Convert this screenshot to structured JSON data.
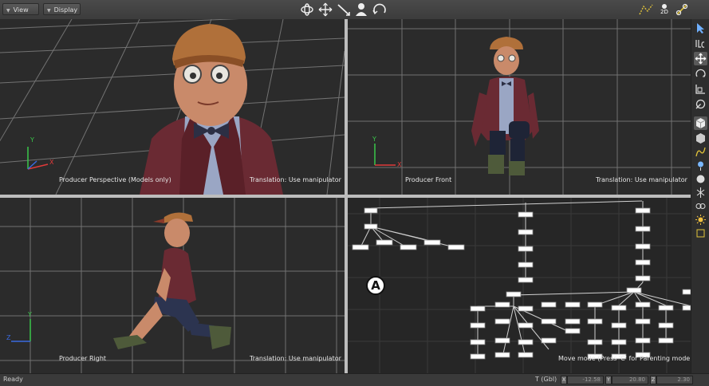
{
  "menu": {
    "view_label": "View",
    "display_label": "Display"
  },
  "toolbar": {
    "view_2d_label": "2D"
  },
  "viewports": {
    "perspective": {
      "name": "Producer Perspective (Models only)",
      "mode": "Translation: Use manipulator"
    },
    "front": {
      "name": "Producer Front",
      "mode": "Translation: Use manipulator"
    },
    "right": {
      "name": "Producer Right",
      "mode": "Translation: Use manipulator"
    },
    "schematic": {
      "mode": "Move mode (Press 'C' for Parenting mode)",
      "marker": "A"
    }
  },
  "axes": {
    "x": "X",
    "y": "Y",
    "z": "Z"
  },
  "status": {
    "text": "Ready",
    "transform_label": "T (Gbl)",
    "x_tag": "X",
    "x_value": "-12.58",
    "y_tag": "Y",
    "y_value": "20.80",
    "z_tag": "Z",
    "z_value": "2.30"
  },
  "colors": {
    "viewport_bg": "#2b2b2b",
    "grid": "#8a8a8a",
    "jacket": "#6a2a33",
    "shirt": "#9aa6c4",
    "cap": "#b0703a",
    "skin": "#c98a6a",
    "axis_x": "#e03a3a",
    "axis_y": "#3ac84a",
    "axis_z": "#3a6ae0"
  }
}
